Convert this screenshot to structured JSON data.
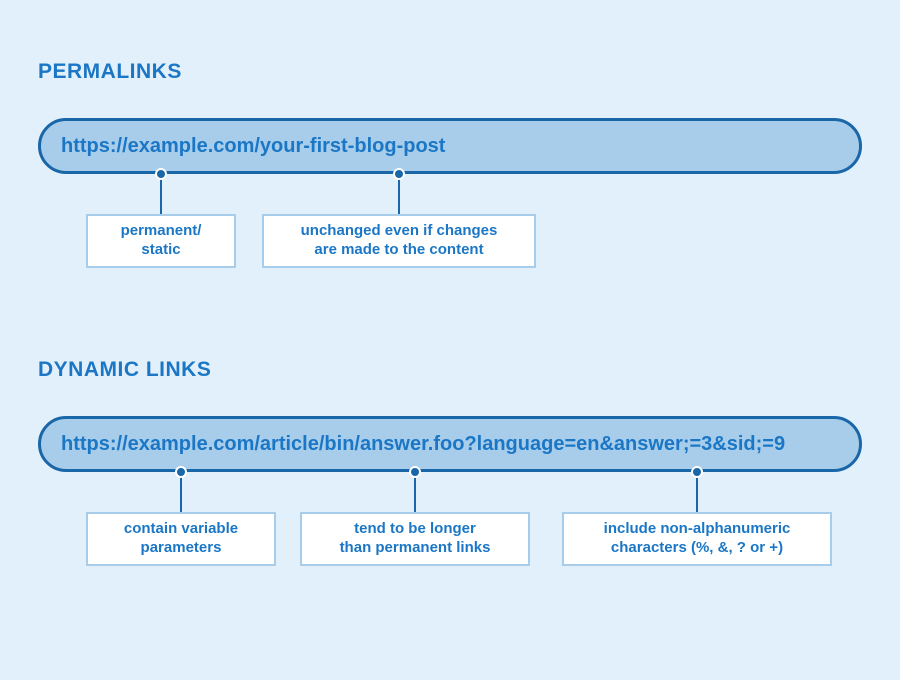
{
  "permalinks": {
    "title": "PERMALINKS",
    "url": "https://example.com/your-first-blog-post",
    "annotations": [
      "permanent/\nstatic",
      "unchanged even if changes\nare made to the content"
    ]
  },
  "dynamic": {
    "title": "DYNAMIC LINKS",
    "url": "https://example.com/article/bin/answer.foo?language=en&answer;=3&sid;=9",
    "annotations": [
      "contain variable\nparameters",
      "tend to be longer\nthan permanent links",
      "include non-alphanumeric\ncharacters (%, &, ? or +)"
    ]
  }
}
